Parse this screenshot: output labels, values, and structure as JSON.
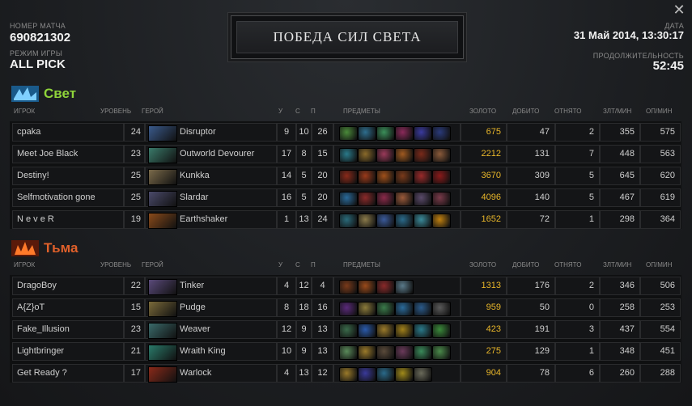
{
  "header": {
    "match_id_label": "НОМЕР МАТЧА",
    "match_id": "690821302",
    "mode_label": "РЕЖИМ ИГРЫ",
    "mode": "ALL PICK",
    "banner": "ПОБЕДА СИЛ СВЕТА",
    "date_label": "ДАТА",
    "date": "31 Май 2014, 13:30:17",
    "duration_label": "ПРОДОЛЖИТЕЛЬНОСТЬ",
    "duration": "52:45",
    "close_icon": "close-icon"
  },
  "columns": {
    "player": "ИГРОК",
    "level": "УРОВЕНЬ",
    "hero": "ГЕРОЙ",
    "kills": "У",
    "deaths": "С",
    "assists": "П",
    "items": "ПРЕДМЕТЫ",
    "gold": "ЗОЛОТО",
    "last_hits": "ДОБИТО",
    "denies": "ОТНЯТО",
    "gpm": "ЗЛТ/МИН",
    "xpm": "ОП/МИН"
  },
  "radiant": {
    "name": "Свет",
    "color": "#8fd43a",
    "players": [
      {
        "name": "cpaka",
        "level": "24",
        "hero": "Disruptor",
        "hero_color": "#3a5a8c",
        "k": "9",
        "d": "10",
        "a": "26",
        "items": [
          "#4a8a3a",
          "#2e6e8e",
          "#3b8f5a",
          "#8a2a5a",
          "#3a3a9e",
          "#2a3a7a"
        ],
        "gold": "675",
        "lh": "47",
        "dn": "2",
        "gpm": "355",
        "xpm": "575"
      },
      {
        "name": "Meet Joe Black",
        "level": "23",
        "hero": "Outworld Devourer",
        "hero_color": "#3a7a6a",
        "k": "17",
        "d": "8",
        "a": "15",
        "items": [
          "#2a7a8a",
          "#8a6a2a",
          "#9a3a5a",
          "#a05a20",
          "#7a2a1a",
          "#8a5a3a"
        ],
        "gold": "2212",
        "lh": "131",
        "dn": "7",
        "gpm": "448",
        "xpm": "563"
      },
      {
        "name": "Destiny!",
        "level": "25",
        "hero": "Kunkka",
        "hero_color": "#7a6a4a",
        "k": "14",
        "d": "5",
        "a": "20",
        "items": [
          "#8a2a1a",
          "#9a3a1a",
          "#a0501a",
          "#7a3a1a",
          "#9a2a2a",
          "#8a1a1a"
        ],
        "gold": "3670",
        "lh": "309",
        "dn": "5",
        "gpm": "645",
        "xpm": "620"
      },
      {
        "name": "Selfmotivation gone",
        "level": "25",
        "hero": "Slardar",
        "hero_color": "#4a4a6a",
        "k": "16",
        "d": "5",
        "a": "20",
        "items": [
          "#2a6a9a",
          "#8a2a2a",
          "#8a2a4a",
          "#9a5a3a",
          "#5a4a6a",
          "#7a3a4a"
        ],
        "gold": "4096",
        "lh": "140",
        "dn": "5",
        "gpm": "467",
        "xpm": "619"
      },
      {
        "name": "N e v e R",
        "level": "19",
        "hero": "Earthshaker",
        "hero_color": "#8a4a1a",
        "k": "1",
        "d": "13",
        "a": "24",
        "items": [
          "#2a6a7a",
          "#8a7a4a",
          "#3a5a9a",
          "#2a6a8a",
          "#3a8a9a",
          "#c08010"
        ],
        "gold": "1652",
        "lh": "72",
        "dn": "1",
        "gpm": "298",
        "xpm": "364"
      }
    ]
  },
  "dire": {
    "name": "Тьма",
    "color": "#e0602a",
    "players": [
      {
        "name": "DragoBoy",
        "level": "22",
        "hero": "Tinker",
        "hero_color": "#5a4a7a",
        "k": "4",
        "d": "12",
        "a": "4",
        "items": [
          "#7a3a1a",
          "#9a4a1a",
          "#8a2a2a",
          "#5a7a8a"
        ],
        "gold": "1313",
        "lh": "176",
        "dn": "2",
        "gpm": "346",
        "xpm": "506"
      },
      {
        "name": "A{Z}oT",
        "level": "15",
        "hero": "Pudge",
        "hero_color": "#7a6a3a",
        "k": "8",
        "d": "18",
        "a": "16",
        "items": [
          "#5a2a7a",
          "#8a7a3a",
          "#3a7a4a",
          "#2a6a9a",
          "#2a5a8a",
          "#5a5a5a"
        ],
        "gold": "959",
        "lh": "50",
        "dn": "0",
        "gpm": "258",
        "xpm": "253"
      },
      {
        "name": "Fake_Illusion",
        "level": "23",
        "hero": "Weaver",
        "hero_color": "#3a6a6a",
        "k": "12",
        "d": "9",
        "a": "13",
        "items": [
          "#3a6a4a",
          "#2a5aaa",
          "#9a7a2a",
          "#a0801a",
          "#2a7a8a",
          "#3a8a3a"
        ],
        "gold": "423",
        "lh": "191",
        "dn": "3",
        "gpm": "437",
        "xpm": "554"
      },
      {
        "name": "Lightbringer",
        "level": "21",
        "hero": "Wraith King",
        "hero_color": "#2a7a6a",
        "k": "10",
        "d": "9",
        "a": "13",
        "items": [
          "#5a8a5a",
          "#9a7a2a",
          "#5a4a3a",
          "#6a3a5a",
          "#3a8a5a",
          "#4a8a4a"
        ],
        "gold": "275",
        "lh": "129",
        "dn": "1",
        "gpm": "348",
        "xpm": "451"
      },
      {
        "name": "Get Ready ?",
        "level": "17",
        "hero": "Warlock",
        "hero_color": "#8a2a1a",
        "k": "4",
        "d": "13",
        "a": "12",
        "items": [
          "#9a7a2a",
          "#3a3a9a",
          "#2a6a8a",
          "#a08a1a",
          "#6a6a5a"
        ],
        "gold": "904",
        "lh": "78",
        "dn": "6",
        "gpm": "260",
        "xpm": "288"
      }
    ]
  }
}
